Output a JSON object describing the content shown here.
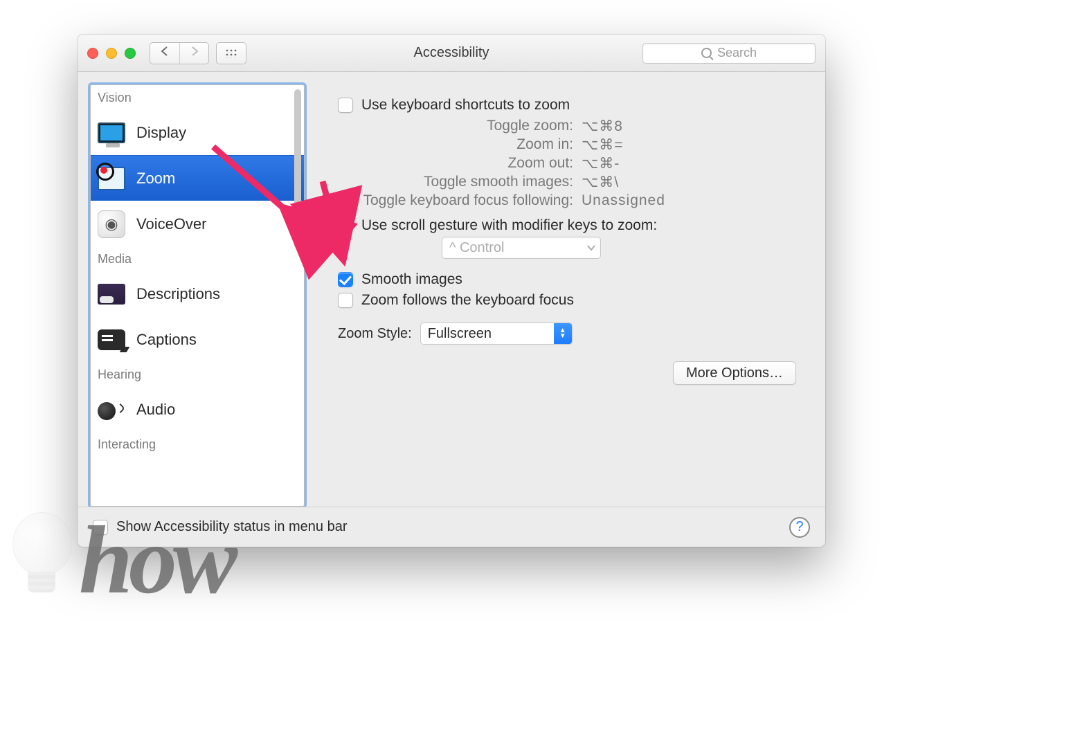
{
  "window": {
    "title": "Accessibility"
  },
  "toolbar": {
    "search_placeholder": "Search"
  },
  "sidebar": {
    "sections": {
      "vision": "Vision",
      "media": "Media",
      "hearing": "Hearing",
      "interacting": "Interacting"
    },
    "items": {
      "display": "Display",
      "zoom": "Zoom",
      "voiceover": "VoiceOver",
      "descriptions": "Descriptions",
      "captions": "Captions",
      "audio": "Audio"
    },
    "selected": "zoom"
  },
  "main": {
    "use_keyboard_shortcuts": "Use keyboard shortcuts to zoom",
    "shortcuts": {
      "toggle_zoom_label": "Toggle zoom:",
      "toggle_zoom_value": "⌥⌘8",
      "zoom_in_label": "Zoom in:",
      "zoom_in_value": "⌥⌘=",
      "zoom_out_label": "Zoom out:",
      "zoom_out_value": "⌥⌘-",
      "toggle_smooth_label": "Toggle smooth images:",
      "toggle_smooth_value": "⌥⌘\\",
      "toggle_focus_label": "Toggle keyboard focus following:",
      "toggle_focus_value": "Unassigned"
    },
    "use_scroll_gesture": "Use scroll gesture with modifier keys to zoom:",
    "modifier_selected": "^ Control",
    "smooth_images": "Smooth images",
    "zoom_follows_focus": "Zoom follows the keyboard focus",
    "zoom_style_label": "Zoom Style:",
    "zoom_style_value": "Fullscreen",
    "more_options": "More Options…"
  },
  "footer": {
    "show_status": "Show Accessibility status in menu bar"
  },
  "watermark": {
    "text": "how"
  }
}
